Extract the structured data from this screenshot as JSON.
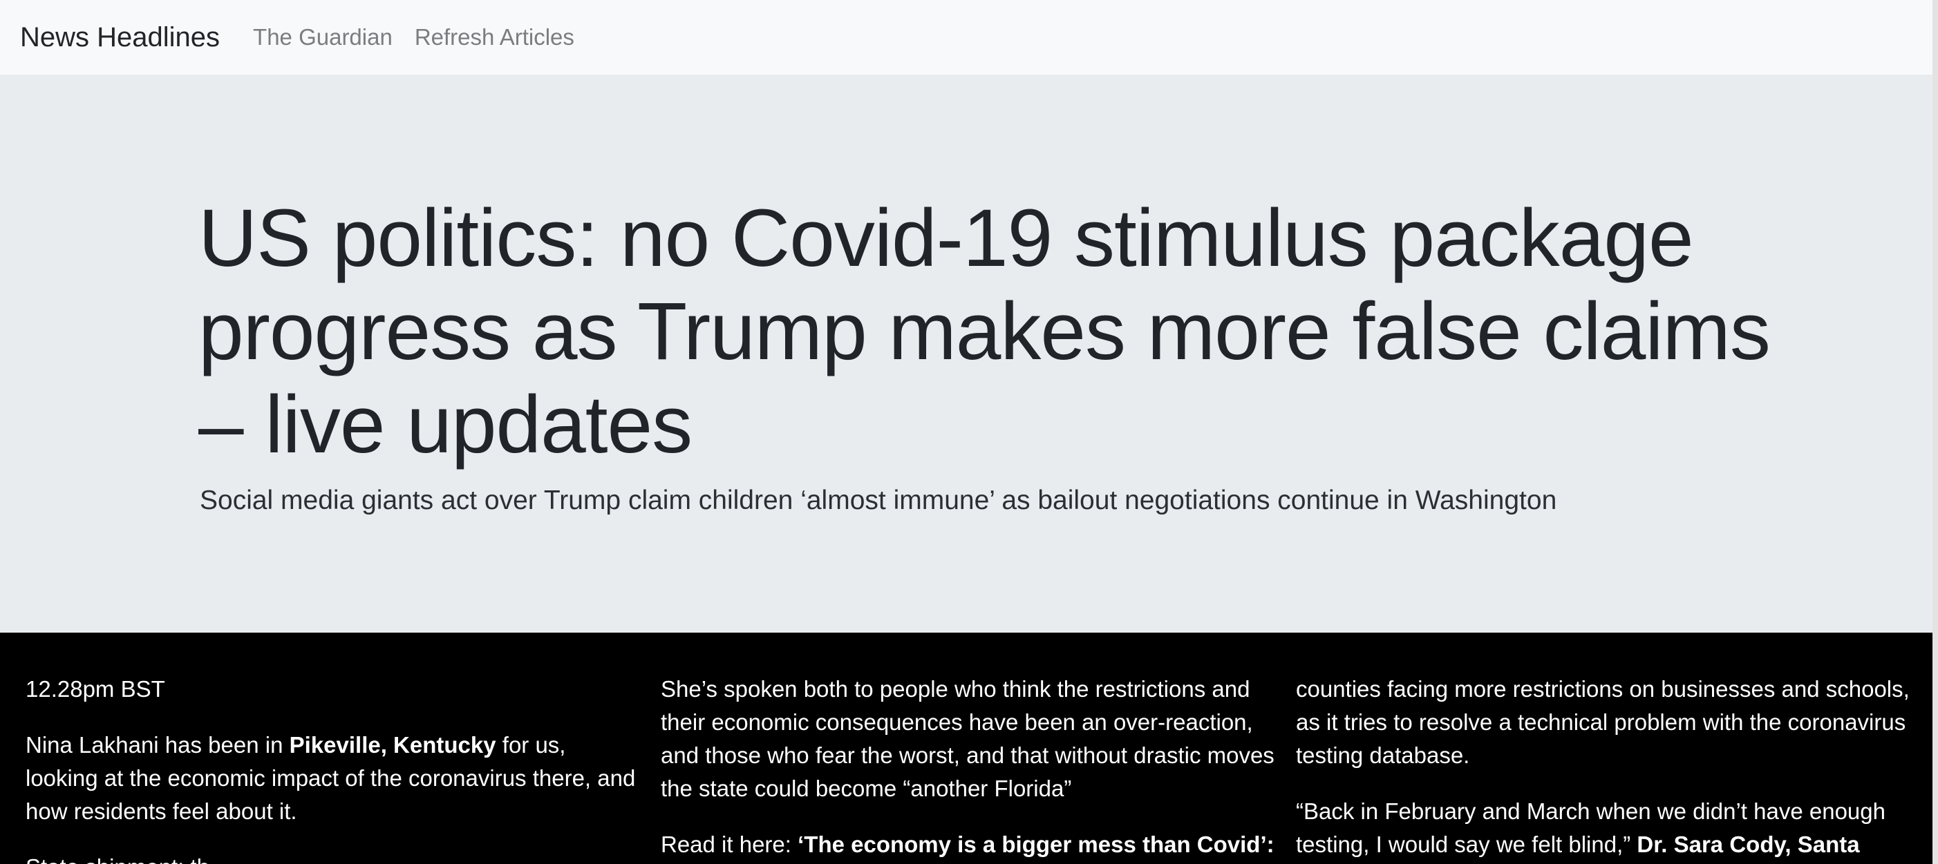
{
  "nav": {
    "brand": "News Headlines",
    "links": [
      {
        "label": "The Guardian"
      },
      {
        "label": "Refresh Articles"
      }
    ]
  },
  "jumbotron": {
    "headline": "US politics: no Covid-19 stimulus package progress as Trump makes more false claims – live updates",
    "standfirst": "Social media giants act over Trump claim children ‘almost immune’ as bailout negotiations continue in Washington"
  },
  "article": {
    "col1": {
      "time": "12.28pm BST",
      "p1_a": "Nina Lakhani has been in ",
      "p1_bold": "Pikeville, Kentucky",
      "p1_b": " for us, looking at the economic impact of the coronavirus there, and how residents feel about it.",
      "p2": "State shipment: th..."
    },
    "col2": {
      "p1": "She’s spoken both to people who think the restrictions and their economic consequences have been an over-reaction, and those who fear the worst, and that without drastic moves the state could become “another Florida”",
      "p2_a": "Read it here: ",
      "p2_bold": "‘The economy is a bigger mess than Covid’:"
    },
    "col3": {
      "p1": "counties facing more restrictions on businesses and schools, as it tries to resolve a technical problem with the coronavirus testing database.",
      "p2_a": "“Back in February and March when we didn’t have enough testing, I would say we felt blind,” ",
      "p2_bold": "Dr. Sara Cody, Santa"
    }
  }
}
